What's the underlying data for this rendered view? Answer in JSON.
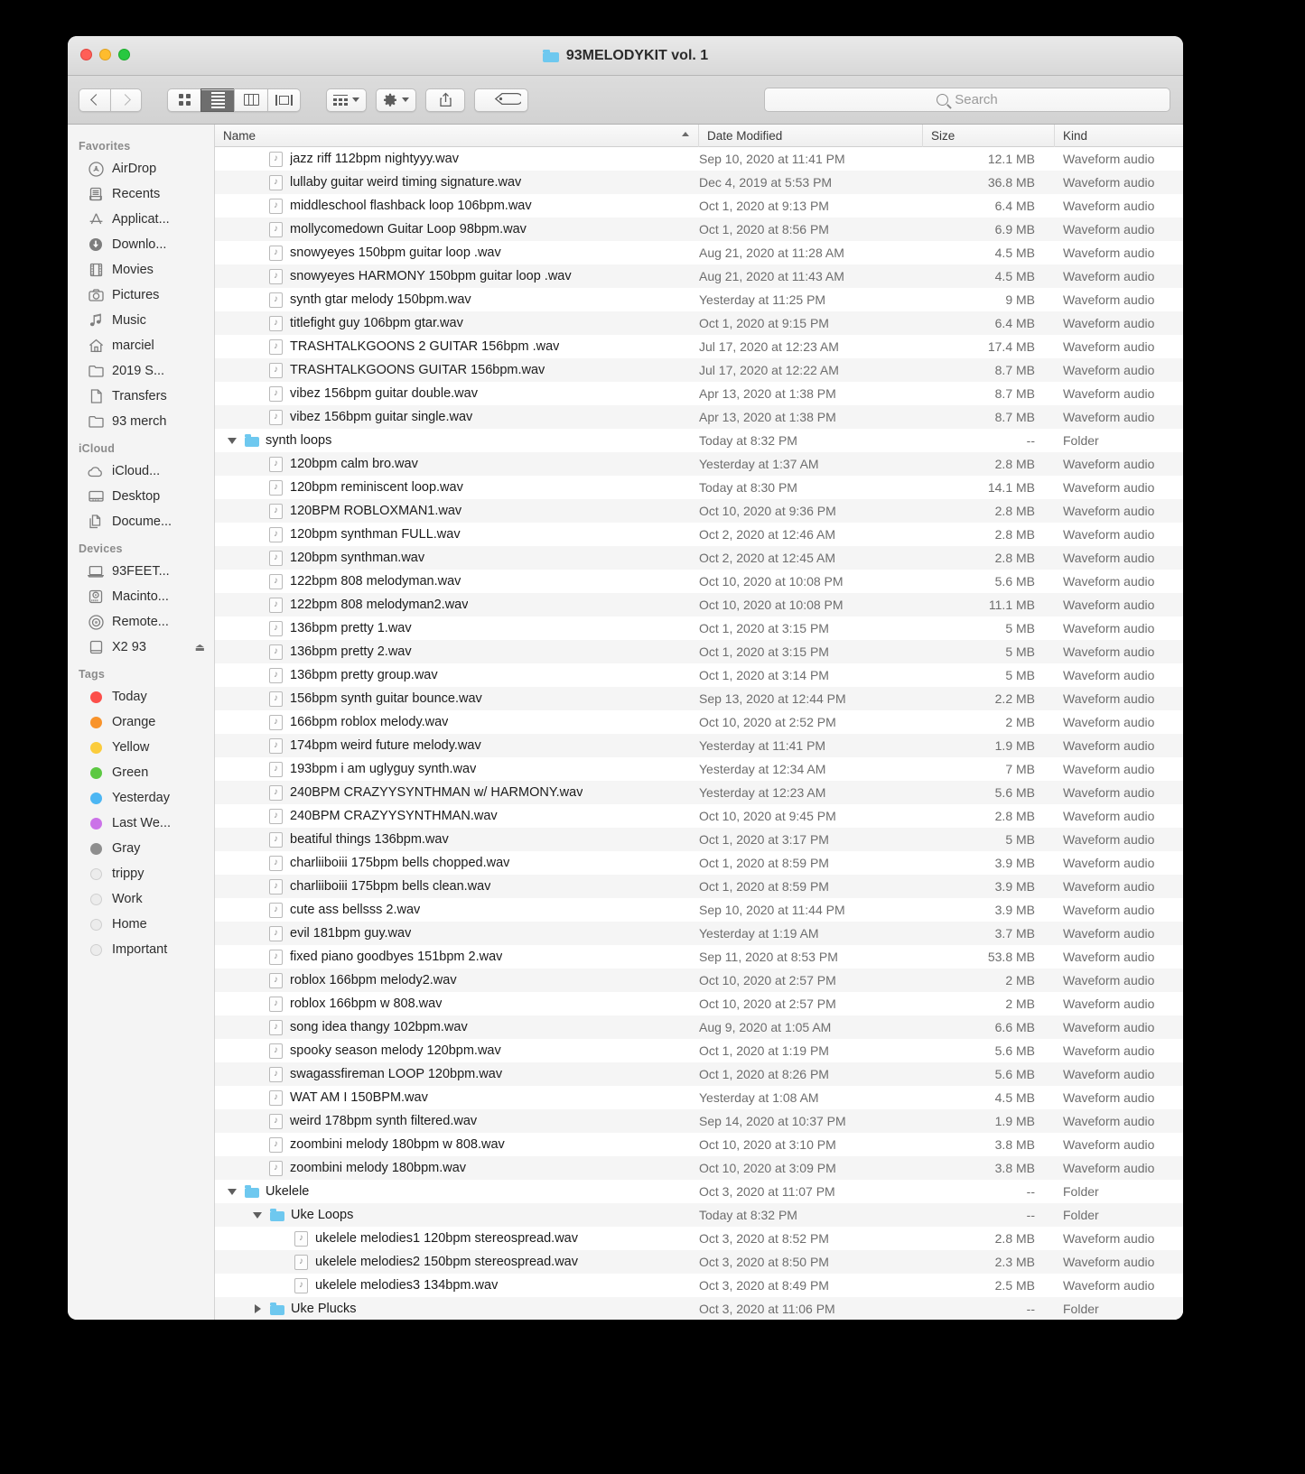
{
  "window": {
    "title": "93MELODYKIT vol. 1",
    "title_icon": "folder-icon",
    "traffic_lights": [
      "close-button",
      "minimize-button",
      "zoom-button"
    ]
  },
  "toolbar": {
    "back_label": "",
    "forward_label": "",
    "view_modes": [
      {
        "name": "icon-view",
        "icon": "grid-icon",
        "active": false
      },
      {
        "name": "list-view",
        "icon": "list-icon",
        "active": true
      },
      {
        "name": "column-view",
        "icon": "columns-icon",
        "active": false
      },
      {
        "name": "gallery-view",
        "icon": "coverflow-icon",
        "active": false
      }
    ],
    "arrange_icon": "arrange-icon",
    "action_icon": "gear-icon",
    "share_icon": "share-icon",
    "tag_icon": "tag-icon"
  },
  "search": {
    "placeholder": "Search",
    "value": "",
    "icon": "search-icon"
  },
  "sidebar": {
    "sections": [
      {
        "header": "Favorites",
        "items": [
          {
            "label": "AirDrop",
            "icon": "airdrop-icon"
          },
          {
            "label": "Recents",
            "icon": "recents-icon"
          },
          {
            "label": "Applicat...",
            "icon": "applications-icon"
          },
          {
            "label": "Downlo...",
            "icon": "downloads-icon"
          },
          {
            "label": "Movies",
            "icon": "movies-icon"
          },
          {
            "label": "Pictures",
            "icon": "pictures-icon"
          },
          {
            "label": "Music",
            "icon": "music-icon"
          },
          {
            "label": "marciel",
            "icon": "home-icon"
          },
          {
            "label": "2019 S...",
            "icon": "folder-icon"
          },
          {
            "label": "Transfers",
            "icon": "document-icon"
          },
          {
            "label": "93 merch",
            "icon": "folder-icon"
          }
        ]
      },
      {
        "header": "iCloud",
        "items": [
          {
            "label": "iCloud...",
            "icon": "cloud-icon"
          },
          {
            "label": "Desktop",
            "icon": "desktop-icon"
          },
          {
            "label": "Docume...",
            "icon": "documents-icon"
          }
        ]
      },
      {
        "header": "Devices",
        "items": [
          {
            "label": "93FEET...",
            "icon": "laptop-icon"
          },
          {
            "label": "Macinto...",
            "icon": "harddisk-icon"
          },
          {
            "label": "Remote...",
            "icon": "disc-icon"
          },
          {
            "label": "X2 93",
            "icon": "external-drive-icon",
            "eject": "⏏"
          }
        ]
      },
      {
        "header": "Tags",
        "items": [
          {
            "label": "Today",
            "icon": "tag-dot-icon",
            "color": "#fc4f4a"
          },
          {
            "label": "Orange",
            "icon": "tag-dot-icon",
            "color": "#f8932b"
          },
          {
            "label": "Yellow",
            "icon": "tag-dot-icon",
            "color": "#fbcc3c"
          },
          {
            "label": "Green",
            "icon": "tag-dot-icon",
            "color": "#5cc842"
          },
          {
            "label": "Yesterday",
            "icon": "tag-dot-icon",
            "color": "#4cb6f3"
          },
          {
            "label": "Last We...",
            "icon": "tag-dot-icon",
            "color": "#cb72e8"
          },
          {
            "label": "Gray",
            "icon": "tag-dot-icon",
            "color": "#8e8e8e"
          },
          {
            "label": "trippy",
            "icon": "tag-dot-icon",
            "color": ""
          },
          {
            "label": "Work",
            "icon": "tag-dot-icon",
            "color": ""
          },
          {
            "label": "Home",
            "icon": "tag-dot-icon",
            "color": ""
          },
          {
            "label": "Important",
            "icon": "tag-dot-icon",
            "color": ""
          }
        ]
      }
    ]
  },
  "filelist": {
    "columns": [
      {
        "label": "Name",
        "sort": "ascending"
      },
      {
        "label": "Date Modified"
      },
      {
        "label": "Size"
      },
      {
        "label": "Kind"
      }
    ],
    "rows": [
      {
        "name": "jazz riff 112bpm nightyyy.wav",
        "date": "Sep 10, 2020 at 11:41 PM",
        "size": "12.1 MB",
        "kind": "Waveform audio",
        "type": "file",
        "indent": 1
      },
      {
        "name": "lullaby guitar weird timing signature.wav",
        "date": "Dec 4, 2019 at 5:53 PM",
        "size": "36.8 MB",
        "kind": "Waveform audio",
        "type": "file",
        "indent": 1
      },
      {
        "name": "middleschool flashback loop 106bpm.wav",
        "date": "Oct 1, 2020 at 9:13 PM",
        "size": "6.4 MB",
        "kind": "Waveform audio",
        "type": "file",
        "indent": 1
      },
      {
        "name": "mollycomedown Guitar Loop  98bpm.wav",
        "date": "Oct 1, 2020 at 8:56 PM",
        "size": "6.9 MB",
        "kind": "Waveform audio",
        "type": "file",
        "indent": 1
      },
      {
        "name": "snowyeyes 150bpm guitar loop .wav",
        "date": "Aug 21, 2020 at 11:28 AM",
        "size": "4.5 MB",
        "kind": "Waveform audio",
        "type": "file",
        "indent": 1
      },
      {
        "name": "snowyeyes HARMONY 150bpm guitar loop .wav",
        "date": "Aug 21, 2020 at 11:43 AM",
        "size": "4.5 MB",
        "kind": "Waveform audio",
        "type": "file",
        "indent": 1
      },
      {
        "name": "synth gtar melody 150bpm.wav",
        "date": "Yesterday at 11:25 PM",
        "size": "9 MB",
        "kind": "Waveform audio",
        "type": "file",
        "indent": 1
      },
      {
        "name": "titlefight guy 106bpm gtar.wav",
        "date": "Oct 1, 2020 at 9:15 PM",
        "size": "6.4 MB",
        "kind": "Waveform audio",
        "type": "file",
        "indent": 1
      },
      {
        "name": "TRASHTALKGOONS 2 GUITAR 156bpm .wav",
        "date": "Jul 17, 2020 at 12:23 AM",
        "size": "17.4 MB",
        "kind": "Waveform audio",
        "type": "file",
        "indent": 1
      },
      {
        "name": "TRASHTALKGOONS GUITAR 156bpm.wav",
        "date": "Jul 17, 2020 at 12:22 AM",
        "size": "8.7 MB",
        "kind": "Waveform audio",
        "type": "file",
        "indent": 1
      },
      {
        "name": "vibez 156bpm guitar double.wav",
        "date": "Apr 13, 2020 at 1:38 PM",
        "size": "8.7 MB",
        "kind": "Waveform audio",
        "type": "file",
        "indent": 1
      },
      {
        "name": "vibez 156bpm guitar single.wav",
        "date": "Apr 13, 2020 at 1:38 PM",
        "size": "8.7 MB",
        "kind": "Waveform audio",
        "type": "file",
        "indent": 1
      },
      {
        "name": "synth loops",
        "date": "Today at 8:32 PM",
        "size": "--",
        "kind": "Folder",
        "type": "folder",
        "indent": 0,
        "disclosure": "expanded"
      },
      {
        "name": "120bpm calm bro.wav",
        "date": "Yesterday at 1:37 AM",
        "size": "2.8 MB",
        "kind": "Waveform audio",
        "type": "file",
        "indent": 1
      },
      {
        "name": "120bpm reminiscent loop.wav",
        "date": "Today at 8:30 PM",
        "size": "14.1 MB",
        "kind": "Waveform audio",
        "type": "file",
        "indent": 1
      },
      {
        "name": "120BPM ROBLOXMAN1.wav",
        "date": "Oct 10, 2020 at 9:36 PM",
        "size": "2.8 MB",
        "kind": "Waveform audio",
        "type": "file",
        "indent": 1
      },
      {
        "name": "120bpm synthman FULL.wav",
        "date": "Oct 2, 2020 at 12:46 AM",
        "size": "2.8 MB",
        "kind": "Waveform audio",
        "type": "file",
        "indent": 1
      },
      {
        "name": "120bpm synthman.wav",
        "date": "Oct 2, 2020 at 12:45 AM",
        "size": "2.8 MB",
        "kind": "Waveform audio",
        "type": "file",
        "indent": 1
      },
      {
        "name": "122bpm 808 melodyman.wav",
        "date": "Oct 10, 2020 at 10:08 PM",
        "size": "5.6 MB",
        "kind": "Waveform audio",
        "type": "file",
        "indent": 1
      },
      {
        "name": "122bpm 808 melodyman2.wav",
        "date": "Oct 10, 2020 at 10:08 PM",
        "size": "11.1 MB",
        "kind": "Waveform audio",
        "type": "file",
        "indent": 1
      },
      {
        "name": "136bpm pretty 1.wav",
        "date": "Oct 1, 2020 at 3:15 PM",
        "size": "5 MB",
        "kind": "Waveform audio",
        "type": "file",
        "indent": 1
      },
      {
        "name": "136bpm pretty 2.wav",
        "date": "Oct 1, 2020 at 3:15 PM",
        "size": "5 MB",
        "kind": "Waveform audio",
        "type": "file",
        "indent": 1
      },
      {
        "name": "136bpm pretty group.wav",
        "date": "Oct 1, 2020 at 3:14 PM",
        "size": "5 MB",
        "kind": "Waveform audio",
        "type": "file",
        "indent": 1
      },
      {
        "name": "156bpm synth guitar bounce.wav",
        "date": "Sep 13, 2020 at 12:44 PM",
        "size": "2.2 MB",
        "kind": "Waveform audio",
        "type": "file",
        "indent": 1
      },
      {
        "name": "166bpm roblox melody.wav",
        "date": "Oct 10, 2020 at 2:52 PM",
        "size": "2 MB",
        "kind": "Waveform audio",
        "type": "file",
        "indent": 1
      },
      {
        "name": "174bpm weird future melody.wav",
        "date": "Yesterday at 11:41 PM",
        "size": "1.9 MB",
        "kind": "Waveform audio",
        "type": "file",
        "indent": 1
      },
      {
        "name": "193bpm i am uglyguy synth.wav",
        "date": "Yesterday at 12:34 AM",
        "size": "7 MB",
        "kind": "Waveform audio",
        "type": "file",
        "indent": 1
      },
      {
        "name": "240BPM CRAZYYSYNTHMAN w/ HARMONY.wav",
        "date": "Yesterday at 12:23 AM",
        "size": "5.6 MB",
        "kind": "Waveform audio",
        "type": "file",
        "indent": 1
      },
      {
        "name": "240BPM CRAZYYSYNTHMAN.wav",
        "date": "Oct 10, 2020 at 9:45 PM",
        "size": "2.8 MB",
        "kind": "Waveform audio",
        "type": "file",
        "indent": 1
      },
      {
        "name": "beatiful things 136bpm.wav",
        "date": "Oct 1, 2020 at 3:17 PM",
        "size": "5 MB",
        "kind": "Waveform audio",
        "type": "file",
        "indent": 1
      },
      {
        "name": "charliiboiii 175bpm bells chopped.wav",
        "date": "Oct 1, 2020 at 8:59 PM",
        "size": "3.9 MB",
        "kind": "Waveform audio",
        "type": "file",
        "indent": 1
      },
      {
        "name": "charliiboiii 175bpm bells clean.wav",
        "date": "Oct 1, 2020 at 8:59 PM",
        "size": "3.9 MB",
        "kind": "Waveform audio",
        "type": "file",
        "indent": 1
      },
      {
        "name": "cute ass bellsss 2.wav",
        "date": "Sep 10, 2020 at 11:44 PM",
        "size": "3.9 MB",
        "kind": "Waveform audio",
        "type": "file",
        "indent": 1
      },
      {
        "name": "evil 181bpm guy.wav",
        "date": "Yesterday at 1:19 AM",
        "size": "3.7 MB",
        "kind": "Waveform audio",
        "type": "file",
        "indent": 1
      },
      {
        "name": "fixed piano goodbyes 151bpm 2.wav",
        "date": "Sep 11, 2020 at 8:53 PM",
        "size": "53.8 MB",
        "kind": "Waveform audio",
        "type": "file",
        "indent": 1
      },
      {
        "name": "roblox 166bpm melody2.wav",
        "date": "Oct 10, 2020 at 2:57 PM",
        "size": "2 MB",
        "kind": "Waveform audio",
        "type": "file",
        "indent": 1
      },
      {
        "name": "roblox 166bpm w 808.wav",
        "date": "Oct 10, 2020 at 2:57 PM",
        "size": "2 MB",
        "kind": "Waveform audio",
        "type": "file",
        "indent": 1
      },
      {
        "name": "song idea thangy  102bpm.wav",
        "date": "Aug 9, 2020 at 1:05 AM",
        "size": "6.6 MB",
        "kind": "Waveform audio",
        "type": "file",
        "indent": 1
      },
      {
        "name": "spooky season melody 120bpm.wav",
        "date": "Oct 1, 2020 at 1:19 PM",
        "size": "5.6 MB",
        "kind": "Waveform audio",
        "type": "file",
        "indent": 1
      },
      {
        "name": "swagassfireman LOOP 120bpm.wav",
        "date": "Oct 1, 2020 at 8:26 PM",
        "size": "5.6 MB",
        "kind": "Waveform audio",
        "type": "file",
        "indent": 1
      },
      {
        "name": "WAT AM I 150BPM.wav",
        "date": "Yesterday at 1:08 AM",
        "size": "4.5 MB",
        "kind": "Waveform audio",
        "type": "file",
        "indent": 1
      },
      {
        "name": "weird 178bpm synth filtered.wav",
        "date": "Sep 14, 2020 at 10:37 PM",
        "size": "1.9 MB",
        "kind": "Waveform audio",
        "type": "file",
        "indent": 1
      },
      {
        "name": "zoombini melody 180bpm w 808.wav",
        "date": "Oct 10, 2020 at 3:10 PM",
        "size": "3.8 MB",
        "kind": "Waveform audio",
        "type": "file",
        "indent": 1
      },
      {
        "name": "zoombini melody 180bpm.wav",
        "date": "Oct 10, 2020 at 3:09 PM",
        "size": "3.8 MB",
        "kind": "Waveform audio",
        "type": "file",
        "indent": 1
      },
      {
        "name": "Ukelele",
        "date": "Oct 3, 2020 at 11:07 PM",
        "size": "--",
        "kind": "Folder",
        "type": "folder",
        "indent": 0,
        "disclosure": "expanded"
      },
      {
        "name": "Uke Loops",
        "date": "Today at 8:32 PM",
        "size": "--",
        "kind": "Folder",
        "type": "folder",
        "indent": 1,
        "disclosure": "expanded"
      },
      {
        "name": "ukelele melodies1 120bpm stereospread.wav",
        "date": "Oct 3, 2020 at 8:52 PM",
        "size": "2.8 MB",
        "kind": "Waveform audio",
        "type": "file",
        "indent": 2
      },
      {
        "name": "ukelele melodies2 150bpm stereospread.wav",
        "date": "Oct 3, 2020 at 8:50 PM",
        "size": "2.3 MB",
        "kind": "Waveform audio",
        "type": "file",
        "indent": 2
      },
      {
        "name": "ukelele melodies3 134bpm.wav",
        "date": "Oct 3, 2020 at 8:49 PM",
        "size": "2.5 MB",
        "kind": "Waveform audio",
        "type": "file",
        "indent": 2
      },
      {
        "name": "Uke Plucks",
        "date": "Oct 3, 2020 at 11:06 PM",
        "size": "--",
        "kind": "Folder",
        "type": "folder",
        "indent": 1,
        "disclosure": "collapsed"
      }
    ]
  }
}
